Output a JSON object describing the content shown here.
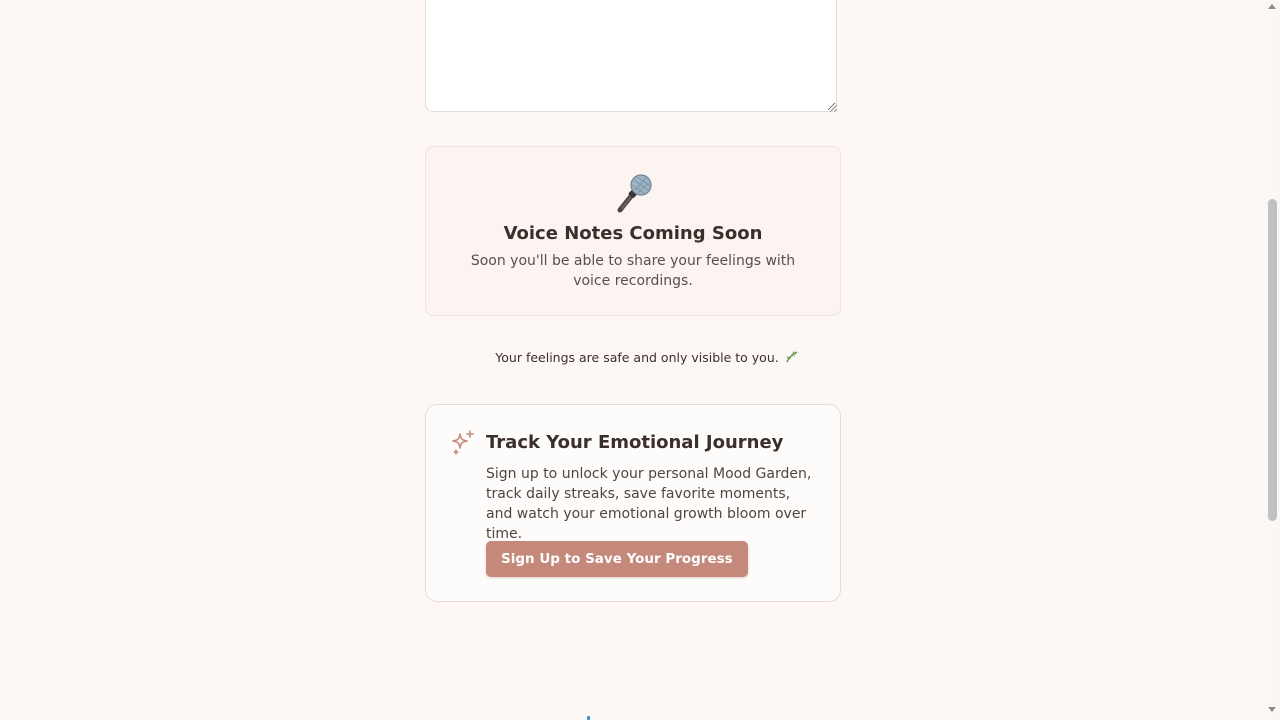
{
  "journal": {
    "placeholder": ""
  },
  "voice_notes": {
    "icon": "microphone-icon",
    "title": "Voice Notes Coming Soon",
    "description": "Soon you'll be able to share your feelings with voice recordings."
  },
  "privacy": {
    "text": "Your feelings are safe and only visible to you.",
    "icon": "leaf-icon"
  },
  "track_journey": {
    "icon": "sparkles-icon",
    "title": "Track Your Emotional Journey",
    "description": "Sign up to unlock your personal Mood Garden, track daily streaks, save favorite moments, and watch your emotional growth bloom over time.",
    "button_label": "Sign Up to Save Your Progress"
  },
  "colors": {
    "background": "#fdf8f5",
    "accent": "#c4897b",
    "heading": "#3b2f2c"
  }
}
